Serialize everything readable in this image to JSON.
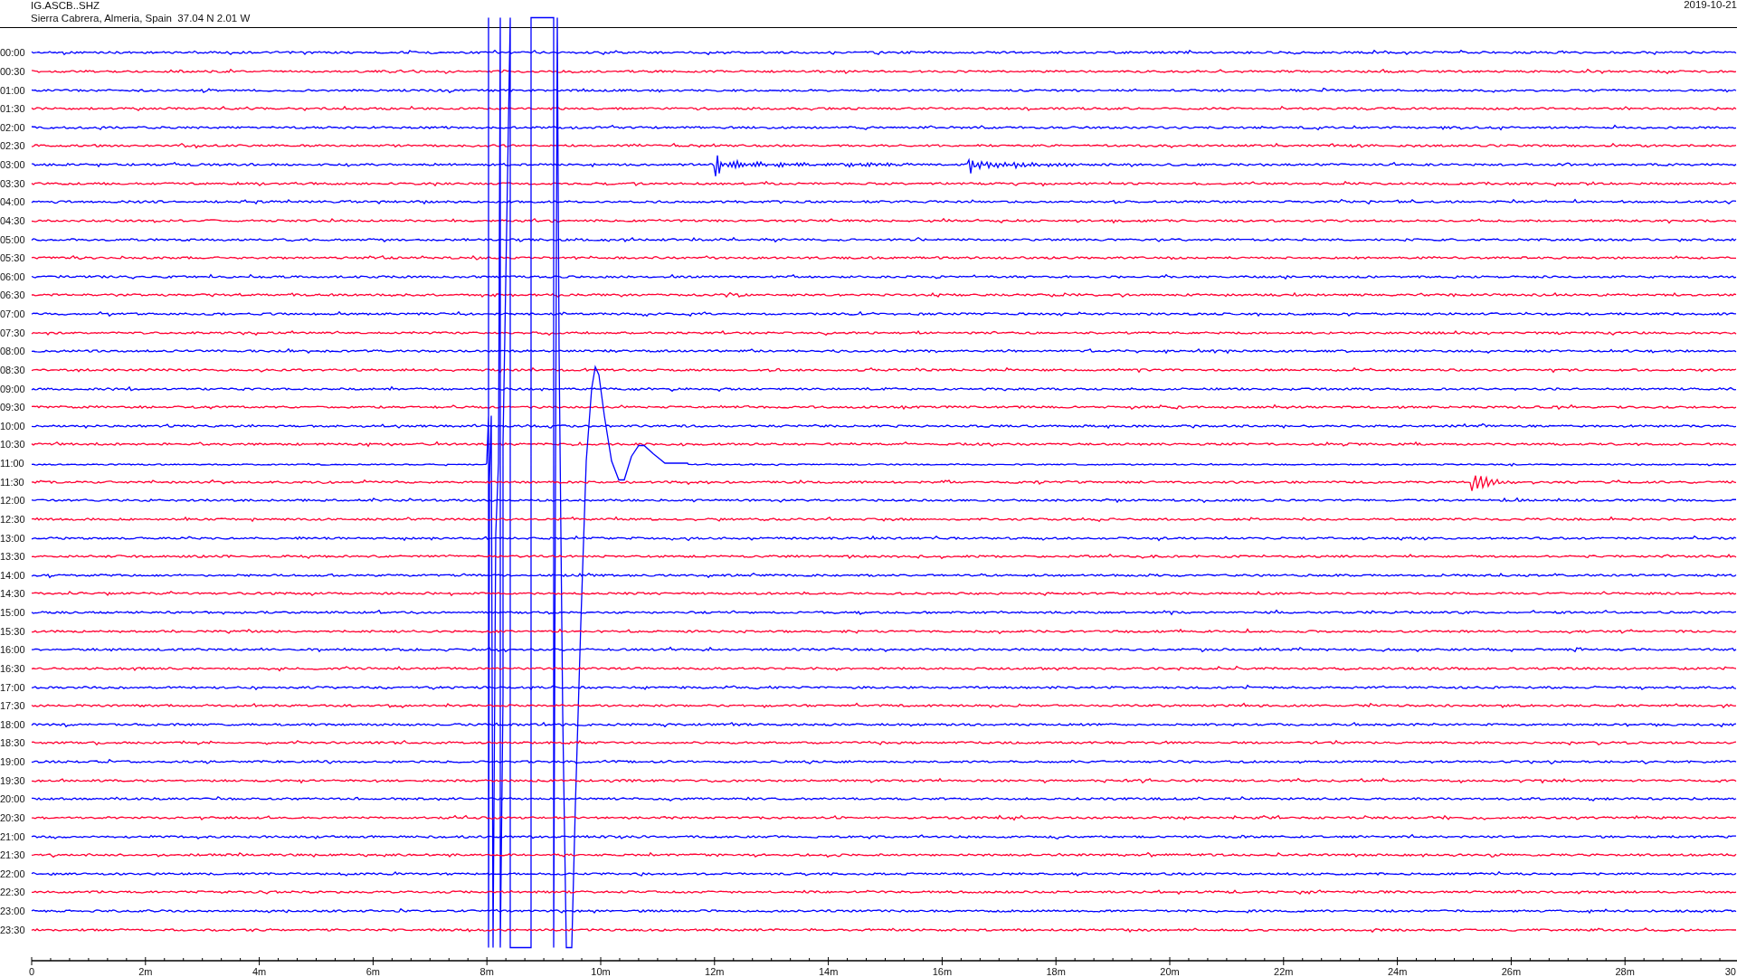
{
  "header": {
    "station": "IG.ASCB..SHZ",
    "location": "Sierra Cabrera, Almeria, Spain  37.04 N 2.01 W",
    "date": "2019-10-21"
  },
  "rows": [
    {
      "time": "00:00",
      "color": "#0000ff"
    },
    {
      "time": "00:30",
      "color": "#ff0033"
    },
    {
      "time": "01:00",
      "color": "#0000ff"
    },
    {
      "time": "01:30",
      "color": "#ff0033"
    },
    {
      "time": "02:00",
      "color": "#0000ff"
    },
    {
      "time": "02:30",
      "color": "#ff0033"
    },
    {
      "time": "03:00",
      "color": "#0000ff"
    },
    {
      "time": "03:30",
      "color": "#ff0033"
    },
    {
      "time": "04:00",
      "color": "#0000ff"
    },
    {
      "time": "04:30",
      "color": "#ff0033"
    },
    {
      "time": "05:00",
      "color": "#0000ff"
    },
    {
      "time": "05:30",
      "color": "#ff0033"
    },
    {
      "time": "06:00",
      "color": "#0000ff"
    },
    {
      "time": "06:30",
      "color": "#ff0033"
    },
    {
      "time": "07:00",
      "color": "#0000ff"
    },
    {
      "time": "07:30",
      "color": "#ff0033"
    },
    {
      "time": "08:00",
      "color": "#0000ff"
    },
    {
      "time": "08:30",
      "color": "#ff0033"
    },
    {
      "time": "09:00",
      "color": "#0000ff"
    },
    {
      "time": "09:30",
      "color": "#ff0033"
    },
    {
      "time": "10:00",
      "color": "#0000ff"
    },
    {
      "time": "10:30",
      "color": "#ff0033"
    },
    {
      "time": "11:00",
      "color": "#0000ff"
    },
    {
      "time": "11:30",
      "color": "#ff0033"
    },
    {
      "time": "12:00",
      "color": "#0000ff"
    },
    {
      "time": "12:30",
      "color": "#ff0033"
    },
    {
      "time": "13:00",
      "color": "#0000ff"
    },
    {
      "time": "13:30",
      "color": "#ff0033"
    },
    {
      "time": "14:00",
      "color": "#0000ff"
    },
    {
      "time": "14:30",
      "color": "#ff0033"
    },
    {
      "time": "15:00",
      "color": "#0000ff"
    },
    {
      "time": "15:30",
      "color": "#ff0033"
    },
    {
      "time": "16:00",
      "color": "#0000ff"
    },
    {
      "time": "16:30",
      "color": "#ff0033"
    },
    {
      "time": "17:00",
      "color": "#0000ff"
    },
    {
      "time": "17:30",
      "color": "#ff0033"
    },
    {
      "time": "18:00",
      "color": "#0000ff"
    },
    {
      "time": "18:30",
      "color": "#ff0033"
    },
    {
      "time": "19:00",
      "color": "#0000ff"
    },
    {
      "time": "19:30",
      "color": "#ff0033"
    },
    {
      "time": "20:00",
      "color": "#0000ff"
    },
    {
      "time": "20:30",
      "color": "#ff0033"
    },
    {
      "time": "21:00",
      "color": "#0000ff"
    },
    {
      "time": "21:30",
      "color": "#ff0033"
    },
    {
      "time": "22:00",
      "color": "#0000ff"
    },
    {
      "time": "22:30",
      "color": "#ff0033"
    },
    {
      "time": "23:00",
      "color": "#0000ff"
    },
    {
      "time": "23:30",
      "color": "#ff0033"
    }
  ],
  "x_axis": {
    "tick_labels": [
      "0",
      "2m",
      "4m",
      "6m",
      "8m",
      "10m",
      "12m",
      "14m",
      "16m",
      "18m",
      "20m",
      "22m",
      "24m",
      "26m",
      "28m",
      "30"
    ]
  }
}
